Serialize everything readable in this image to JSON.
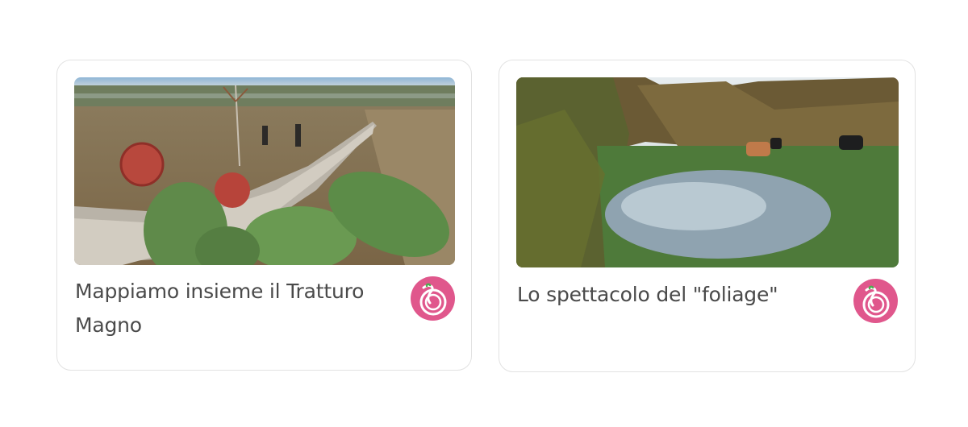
{
  "cards": [
    {
      "title": "Mappiamo insieme il Tratturo Magno",
      "image": "photo-tratturo-cactus-riders",
      "badge_icon": "sprout-logo-icon"
    },
    {
      "title": "Lo spettacolo del \"foliage\"",
      "image": "photo-horses-pond-autumn",
      "badge_icon": "sprout-logo-icon"
    }
  ],
  "colors": {
    "badge": "#e0578c",
    "title_text": "#4a4a4a",
    "card_border": "#e2e2e2"
  }
}
